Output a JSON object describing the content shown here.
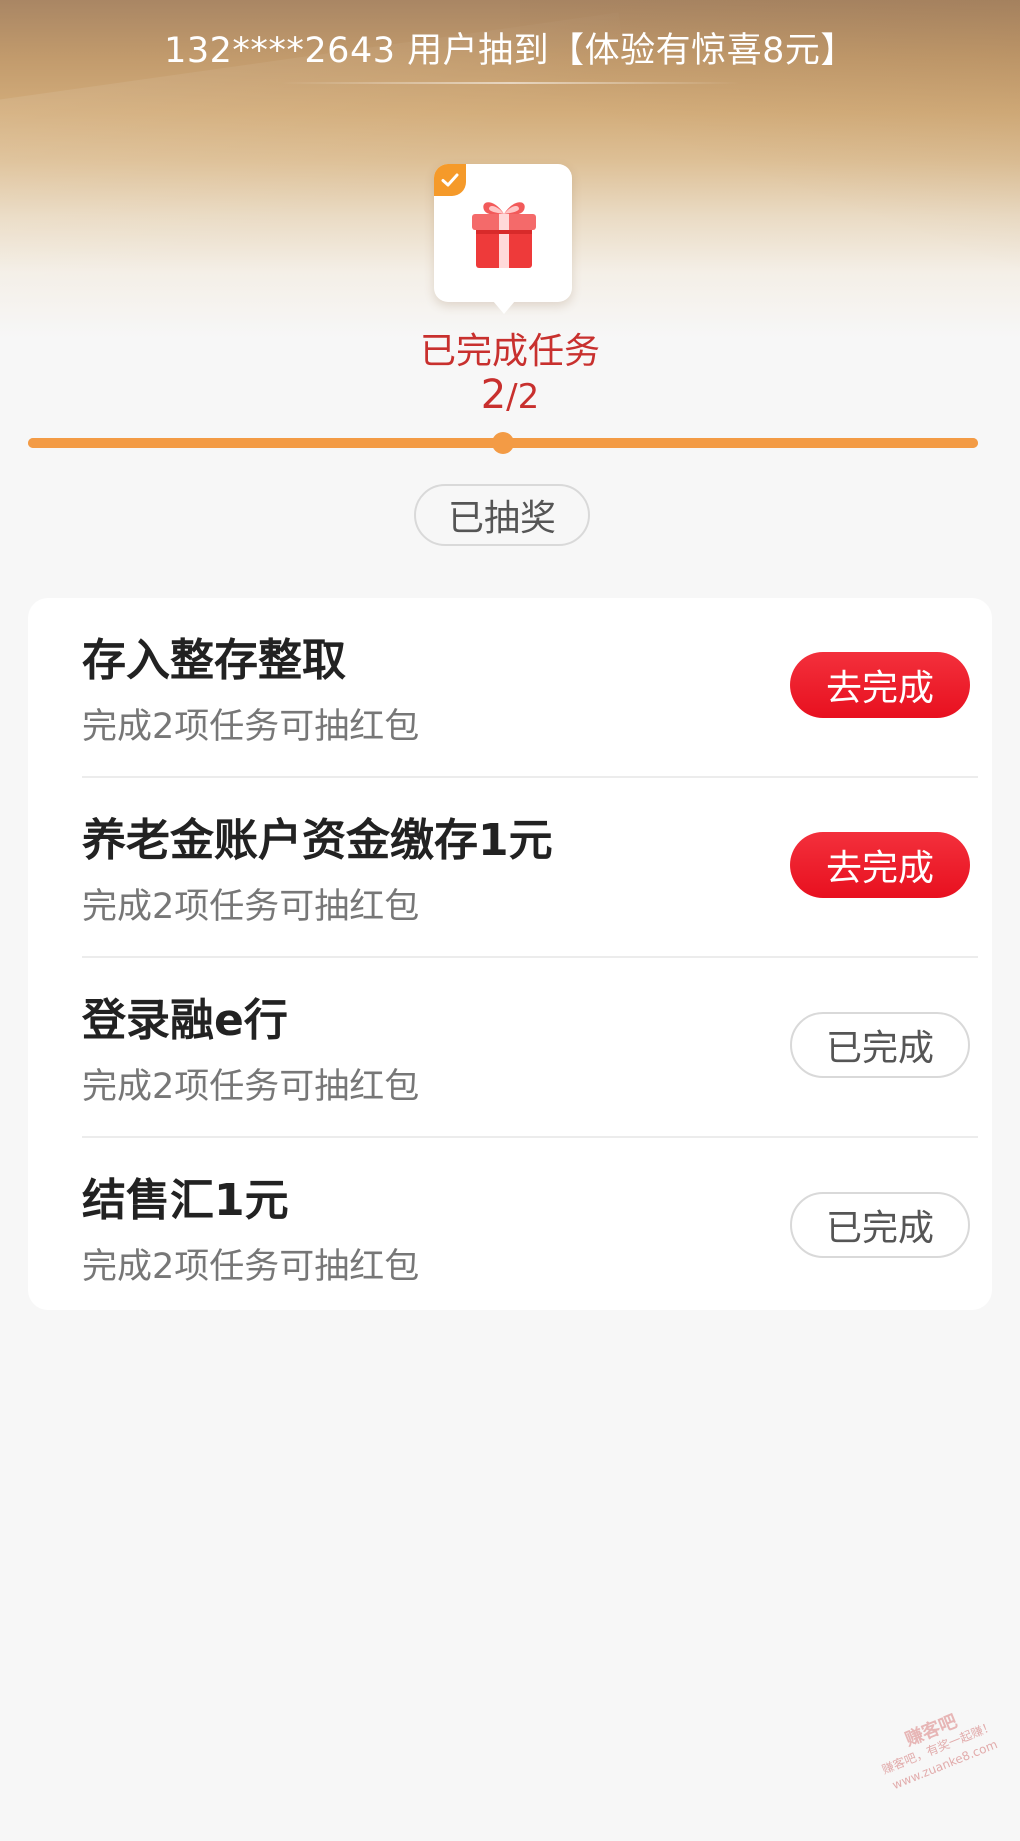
{
  "banner": {
    "ticker_text": "132****2643 用户抽到【体验有惊喜8元】"
  },
  "progress": {
    "caption": "已完成任务",
    "completed": "2",
    "separator": "/",
    "total": "2",
    "fill_fraction": 1.0,
    "marker_fraction": 0.5
  },
  "lottery": {
    "status_label": "已抽奖"
  },
  "tasks": [
    {
      "title": "存入整存整取",
      "subtitle": "完成2项任务可抽红包",
      "action_label": "去完成",
      "state": "pending"
    },
    {
      "title": "养老金账户资金缴存1元",
      "subtitle": "完成2项任务可抽红包",
      "action_label": "去完成",
      "state": "pending"
    },
    {
      "title": "登录融e行",
      "subtitle": "完成2项任务可抽红包",
      "action_label": "已完成",
      "state": "done"
    },
    {
      "title": "结售汇1元",
      "subtitle": "完成2项任务可抽红包",
      "action_label": "已完成",
      "state": "done"
    }
  ],
  "watermark": {
    "logo_text": "赚客吧",
    "text": "赚客吧，有奖一起赚！ www.zuanke8.com"
  },
  "colors": {
    "accent_red": "#e8101f",
    "progress_orange": "#f39b45",
    "caption_red": "#c8302e",
    "badge_orange": "#f59a2a"
  },
  "icons": {
    "gift": "gift-icon",
    "check": "check-icon"
  }
}
